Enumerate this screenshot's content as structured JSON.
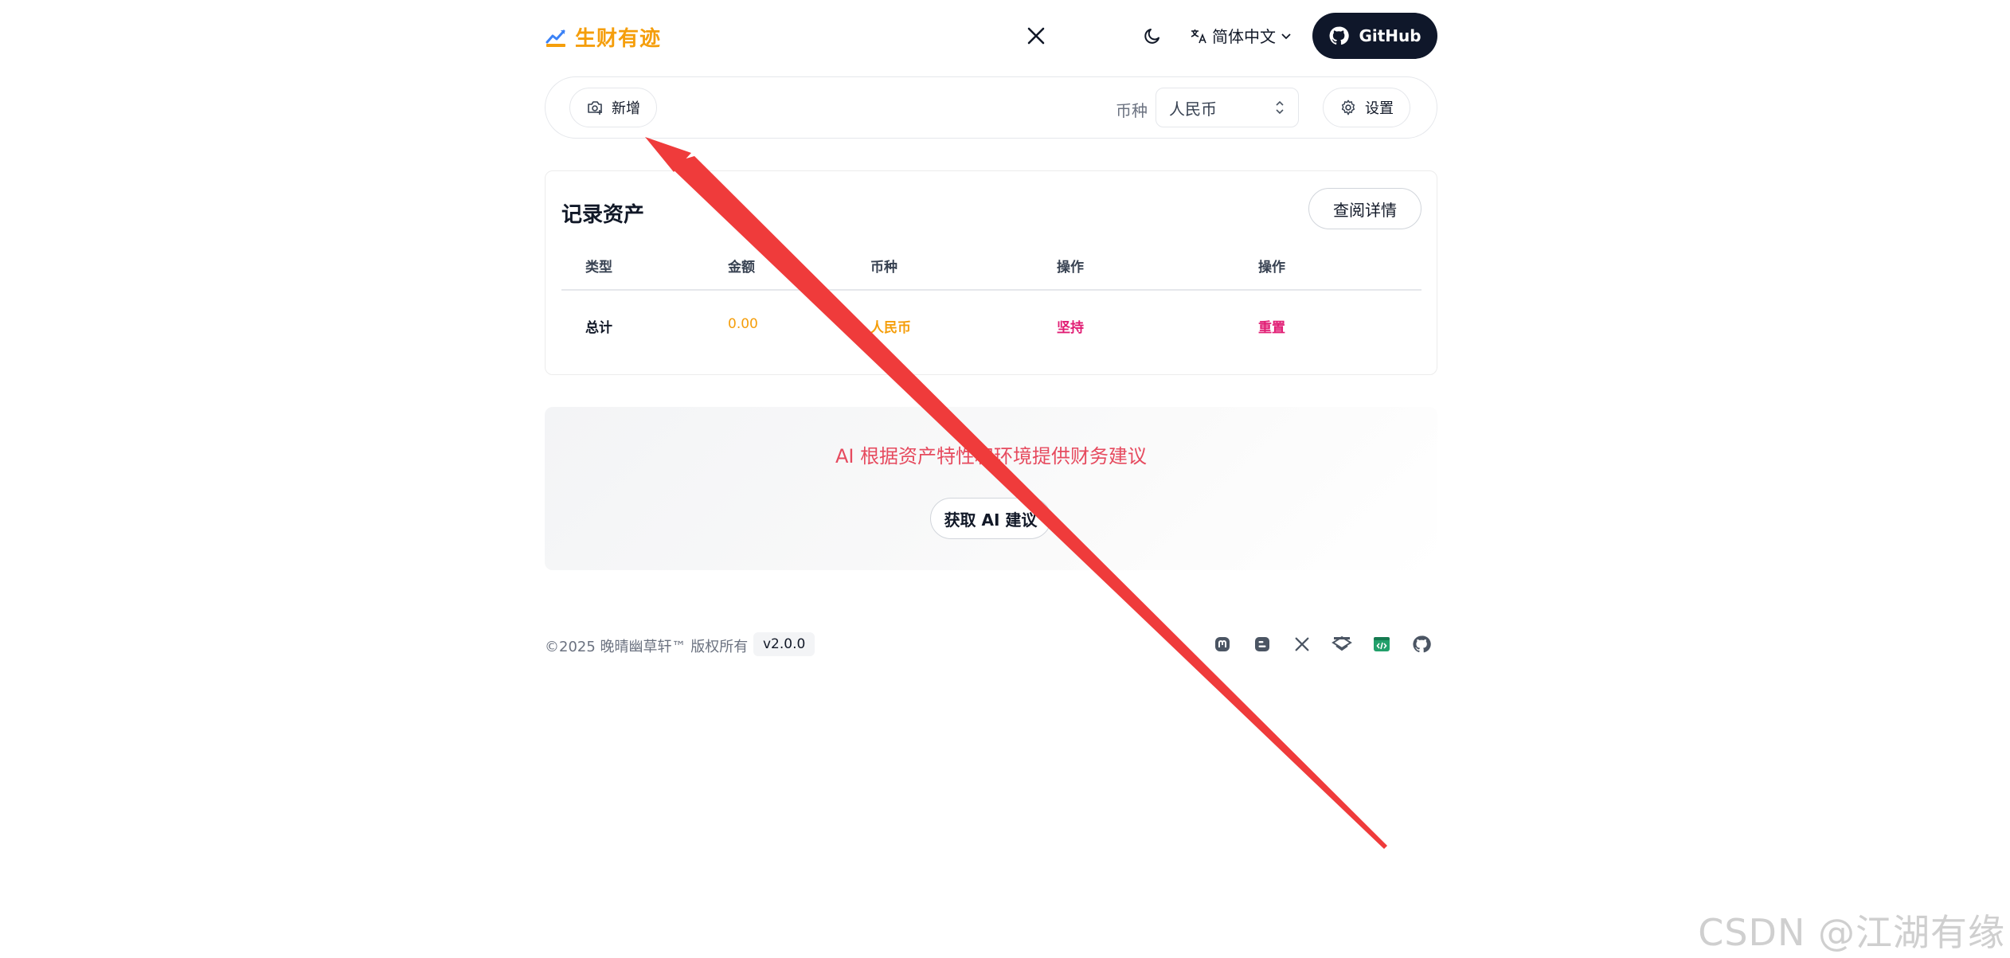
{
  "header": {
    "brand_name": "生财有迹",
    "language_label": "简体中文",
    "github_label": "GitHub"
  },
  "toolbar": {
    "add_label": "新增",
    "currency_label": "币种",
    "currency_value": "人民币",
    "settings_label": "设置"
  },
  "card": {
    "title": "记录资产",
    "detail_label": "查阅详情",
    "columns": [
      "类型",
      "金额",
      "币种",
      "操作",
      "操作"
    ],
    "row": {
      "type": "总计",
      "amount": "0.00",
      "currency": "人民币",
      "action1": "坚持",
      "action2": "重置"
    }
  },
  "ai": {
    "text": "AI 根据资产特性和环境提供财务建议",
    "button_label": "获取 AI 建议"
  },
  "footer": {
    "copyright": "©2025 晚晴幽草轩™ 版权所有",
    "version": "v2.0.0",
    "social_icons": [
      "mastodon-icon",
      "blogger-icon",
      "x-icon",
      "juejin-icon",
      "code-icon",
      "github-icon"
    ]
  },
  "watermark": "CSDN @江湖有缘",
  "colors": {
    "brand": "#f59e0b",
    "dark": "#0f172a",
    "amount": "#f59e0b",
    "action": "#e11d74",
    "ai_text": "#e64a5e",
    "arrow": "#ef3b3b"
  }
}
